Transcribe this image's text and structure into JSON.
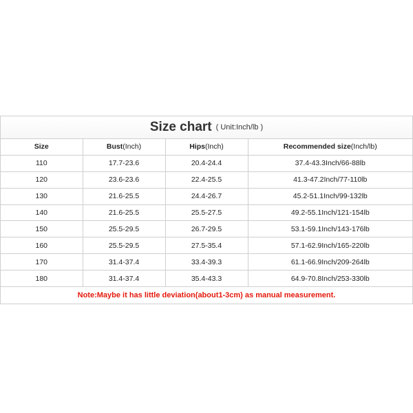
{
  "header": {
    "title": "Size chart",
    "unit": "( Unit:Inch/lb )"
  },
  "columns": [
    {
      "bold": "Size",
      "rest": ""
    },
    {
      "bold": "Bust",
      "rest": "(Inch)"
    },
    {
      "bold": "Hips",
      "rest": "(Inch)"
    },
    {
      "bold": "Recommended size",
      "rest": "(Inch/lb)"
    }
  ],
  "rows": [
    [
      "110",
      "17.7-23.6",
      "20.4-24.4",
      "37.4-43.3Inch/66-88lb"
    ],
    [
      "120",
      "23.6-23.6",
      "22.4-25.5",
      "41.3-47.2Inch/77-110lb"
    ],
    [
      "130",
      "21.6-25.5",
      "24.4-26.7",
      "45.2-51.1Inch/99-132lb"
    ],
    [
      "140",
      "21.6-25.5",
      "25.5-27.5",
      "49.2-55.1Inch/121-154lb"
    ],
    [
      "150",
      "25.5-29.5",
      "26.7-29.5",
      "53.1-59.1Inch/143-176lb"
    ],
    [
      "160",
      "25.5-29.5",
      "27.5-35.4",
      "57.1-62.9Inch/165-220lb"
    ],
    [
      "170",
      "31.4-37.4",
      "33.4-39.3",
      "61.1-66.9Inch/209-264lb"
    ],
    [
      "180",
      "31.4-37.4",
      "35.4-43.3",
      "64.9-70.8Inch/253-330lb"
    ]
  ],
  "note": "Note:Maybe it has little deviation(about1-3cm) as manual measurement.",
  "colors": {
    "note": "#e4190c",
    "border": "#cfcfcf"
  }
}
